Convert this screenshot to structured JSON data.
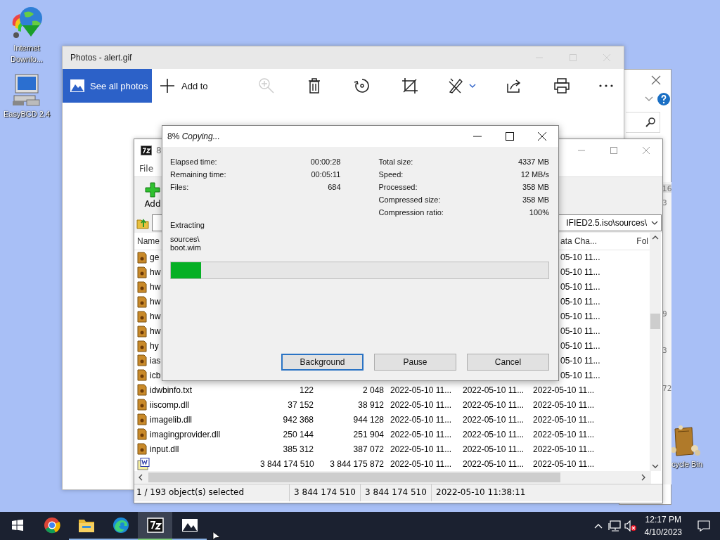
{
  "desktop_icons": [
    {
      "kind": "idm",
      "label": "Internet Downlo..."
    },
    {
      "kind": "bcd",
      "label": "EasyBCD 2.4"
    },
    {
      "kind": "bin",
      "label": "cycle Bin"
    }
  ],
  "explorer_window": {
    "fragments": [
      "16",
      "3",
      "9",
      "3",
      "72"
    ]
  },
  "photos_window": {
    "title": "Photos - alert.gif",
    "see_all": "See all photos",
    "add_to": "Add to",
    "tools": [
      {
        "kind": "zoom",
        "disabled": true
      },
      {
        "kind": "delete",
        "disabled": false
      },
      {
        "kind": "rotate",
        "disabled": false
      },
      {
        "kind": "crop",
        "disabled": false
      },
      {
        "kind": "edit",
        "disabled": false
      },
      {
        "kind": "share",
        "disabled": false
      },
      {
        "kind": "print",
        "disabled": false
      },
      {
        "kind": "more",
        "disabled": false
      }
    ]
  },
  "archive_window": {
    "title": "8",
    "menu": [
      "File"
    ],
    "toolbar": [
      {
        "label": "Add"
      }
    ],
    "address": "IFIED2.5.iso\\sources\\",
    "header": {
      "name": "Name",
      "column_6": "ata Cha...",
      "column_7": "Fol"
    },
    "rows": [
      {
        "kind": "covered",
        "name": "ge",
        "column_6": "05-10 11..."
      },
      {
        "kind": "covered",
        "name": "hw",
        "column_6": "05-10 11..."
      },
      {
        "kind": "covered",
        "name": "hw",
        "column_6": "05-10 11..."
      },
      {
        "kind": "covered",
        "name": "hw",
        "column_6": "05-10 11..."
      },
      {
        "kind": "covered",
        "name": "hw",
        "column_6": "05-10 11..."
      },
      {
        "kind": "covered",
        "name": "hw",
        "column_6": "05-10 11..."
      },
      {
        "kind": "covered",
        "name": "hy",
        "column_6": "05-10 11..."
      },
      {
        "kind": "covered",
        "name": "ias",
        "column_6": "05-10 11..."
      },
      {
        "kind": "covered",
        "name": "icb",
        "column_6": "05-10 11..."
      },
      {
        "kind": "file",
        "name": "idwbinfo.txt",
        "column_2": "122",
        "column_3": "2 048",
        "column_4": "2022-05-10 11...",
        "column_5": "2022-05-10 11...",
        "column_6": "2022-05-10 11..."
      },
      {
        "kind": "file",
        "name": "iiscomp.dll",
        "column_2": "37 152",
        "column_3": "38 912",
        "column_4": "2022-05-10 11...",
        "column_5": "2022-05-10 11...",
        "column_6": "2022-05-10 11..."
      },
      {
        "kind": "file",
        "name": "imagelib.dll",
        "column_2": "942 368",
        "column_3": "944 128",
        "column_4": "2022-05-10 11...",
        "column_5": "2022-05-10 11...",
        "column_6": "2022-05-10 11..."
      },
      {
        "kind": "file",
        "name": "imagingprovider.dll",
        "column_2": "250 144",
        "column_3": "251 904",
        "column_4": "2022-05-10 11...",
        "column_5": "2022-05-10 11...",
        "column_6": "2022-05-10 11..."
      },
      {
        "kind": "file",
        "name": "input.dll",
        "column_2": "385 312",
        "column_3": "387 072",
        "column_4": "2022-05-10 11...",
        "column_5": "2022-05-10 11...",
        "column_6": "2022-05-10 11..."
      },
      {
        "kind": "disc",
        "column_2": "3 844 174 510",
        "column_3": "3 844 175 872",
        "column_4": "2022-05-10 11...",
        "column_5": "2022-05-10 11...",
        "column_6": "2022-05-10 11..."
      }
    ],
    "status": [
      "1 / 193 object(s) selected",
      "3 844 174 510",
      "3 844 174 510",
      "2022-05-10 11:38:11"
    ]
  },
  "dialog": {
    "title": "8% *Copying...*",
    "left_stats": [
      {
        "label": "Elapsed time:",
        "value": "00:00:28"
      },
      {
        "label": "Remaining time:",
        "value": "00:05:11"
      },
      {
        "label": "Files:",
        "value": "684"
      }
    ],
    "right_stats": [
      {
        "label": "Total size:",
        "value": "4337 MB"
      },
      {
        "label": "Speed:",
        "value": "12 MB/s"
      },
      {
        "label": "Processed:",
        "value": "358 MB"
      },
      {
        "label": "Compressed size:",
        "value": "358 MB"
      },
      {
        "label": "Compression ratio:",
        "value": "100%"
      }
    ],
    "operation": "Extracting",
    "path": "sources\\",
    "file": "boot.wim",
    "level": 0.08,
    "buttons": [
      {
        "label": "Background",
        "focused": true
      },
      {
        "label": "Pause",
        "focused": false
      },
      {
        "label": "Cancel",
        "focused": false
      }
    ]
  },
  "taskbar": {
    "apps": [
      {
        "kind": "chrome",
        "running": false,
        "selected": false
      },
      {
        "kind": "explorer",
        "running": true,
        "selected": false
      },
      {
        "kind": "edge",
        "running": true,
        "selected": false
      },
      {
        "kind": "sevenzip",
        "running": true,
        "selected": true
      },
      {
        "kind": "photos",
        "running": true,
        "selected": false
      }
    ],
    "time": "12:17 PM",
    "date": "4/10/2023"
  }
}
